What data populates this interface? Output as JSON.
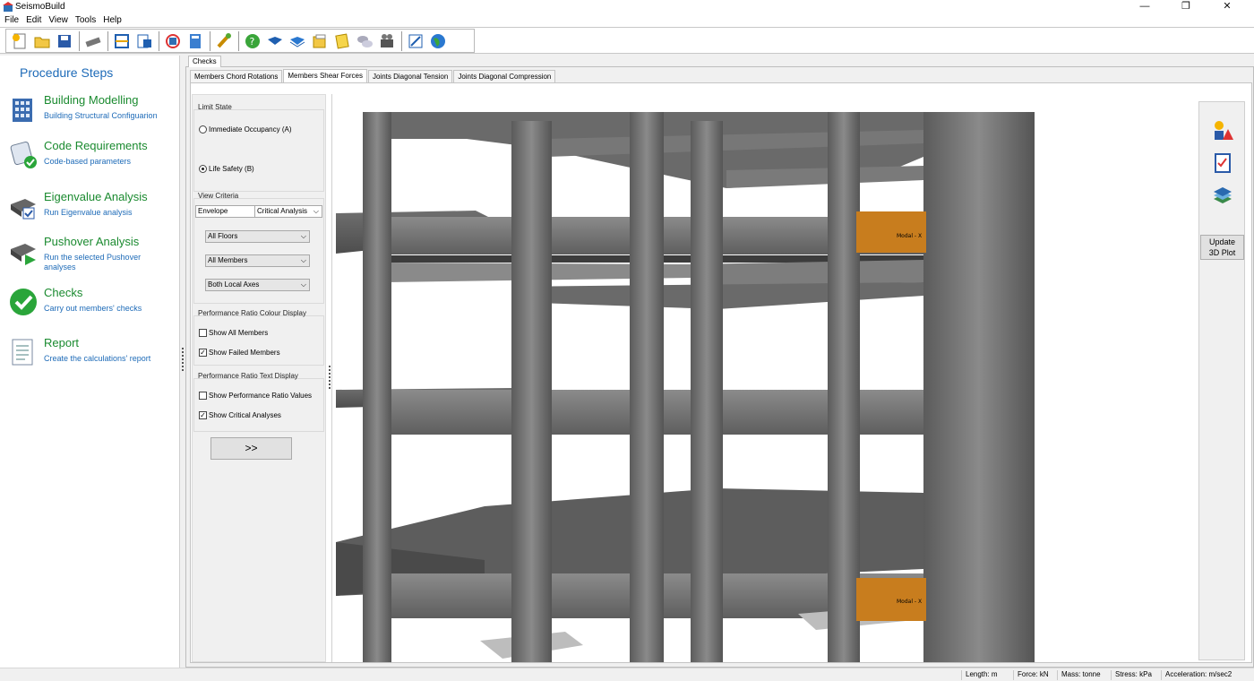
{
  "window": {
    "title": "SeismoBuild",
    "min_glyph": "—",
    "restore_glyph": "❐",
    "close_glyph": "✕"
  },
  "menu": [
    "File",
    "Edit",
    "View",
    "Tools",
    "Help"
  ],
  "toolbar": {
    "groups": [
      [
        "new-project-icon",
        "open-folder-icon",
        "save-icon"
      ],
      [
        "settings-icon"
      ],
      [
        "frame-icon",
        "export-icon"
      ],
      [
        "model-icon",
        "calculator-icon"
      ],
      [
        "brush-icon"
      ],
      [
        "help-icon",
        "book-icon",
        "book-alt-icon",
        "folders-icon",
        "documents-icon",
        "chat-icon",
        "movie-icon"
      ],
      [
        "edit-icon",
        "globe-icon"
      ]
    ]
  },
  "procedure": {
    "title": "Procedure Steps",
    "steps": [
      {
        "title": "Building Modelling",
        "sub": "Building Structural Configuarion",
        "icon": "building-icon"
      },
      {
        "title": "Code Requirements",
        "sub": "Code-based parameters",
        "icon": "scroll-check-icon"
      },
      {
        "title": "Eigenvalue Analysis",
        "sub": "Run Eigenvalue analysis",
        "icon": "eigenvalue-icon"
      },
      {
        "title": "Pushover Analysis",
        "sub": "Run the selected Pushover analyses",
        "icon": "pushover-icon"
      },
      {
        "title": "Checks",
        "sub": "Carry out members' checks",
        "icon": "green-check-icon"
      },
      {
        "title": "Report",
        "sub": "Create the calculations' report",
        "icon": "report-icon"
      }
    ]
  },
  "checks": {
    "tab": "Checks",
    "subtabs": [
      "Members Chord Rotations",
      "Members Shear Forces",
      "Joints Diagonal Tension",
      "Joints Diagonal Compression"
    ],
    "active_subtab": 1
  },
  "controls": {
    "limit_state_label": "Limit State",
    "limit_states": [
      {
        "label": "Immediate Occupancy (A)",
        "selected": false
      },
      {
        "label": "Life Safety (B)",
        "selected": true
      }
    ],
    "view_criteria_label": "View Criteria",
    "envelope_value": "Envelope",
    "analysis_value": "Critical Analysis",
    "floors_value": "All Floors",
    "members_value": "All Members",
    "axes_value": "Both Local Axes",
    "colour_display_label": "Performance Ratio Colour Display",
    "show_all_members": "Show All Members",
    "show_failed_members": "Show Failed Members",
    "text_display_label": "Performance Ratio Text Display",
    "show_ratio_values": "Show Performance Ratio Values",
    "show_critical_analyses": "Show Critical Analyses",
    "next_button": ">>"
  },
  "viewer": {
    "labels": [
      "Modal - X",
      "Modal - X"
    ],
    "update_button_line1": "Update",
    "update_button_line2": "3D Plot"
  },
  "status": {
    "length": "Length: m",
    "force": "Force: kN",
    "mass": "Mass: tonne",
    "stress": "Stress: kPa",
    "acceleration": "Acceleration: m/sec2"
  }
}
